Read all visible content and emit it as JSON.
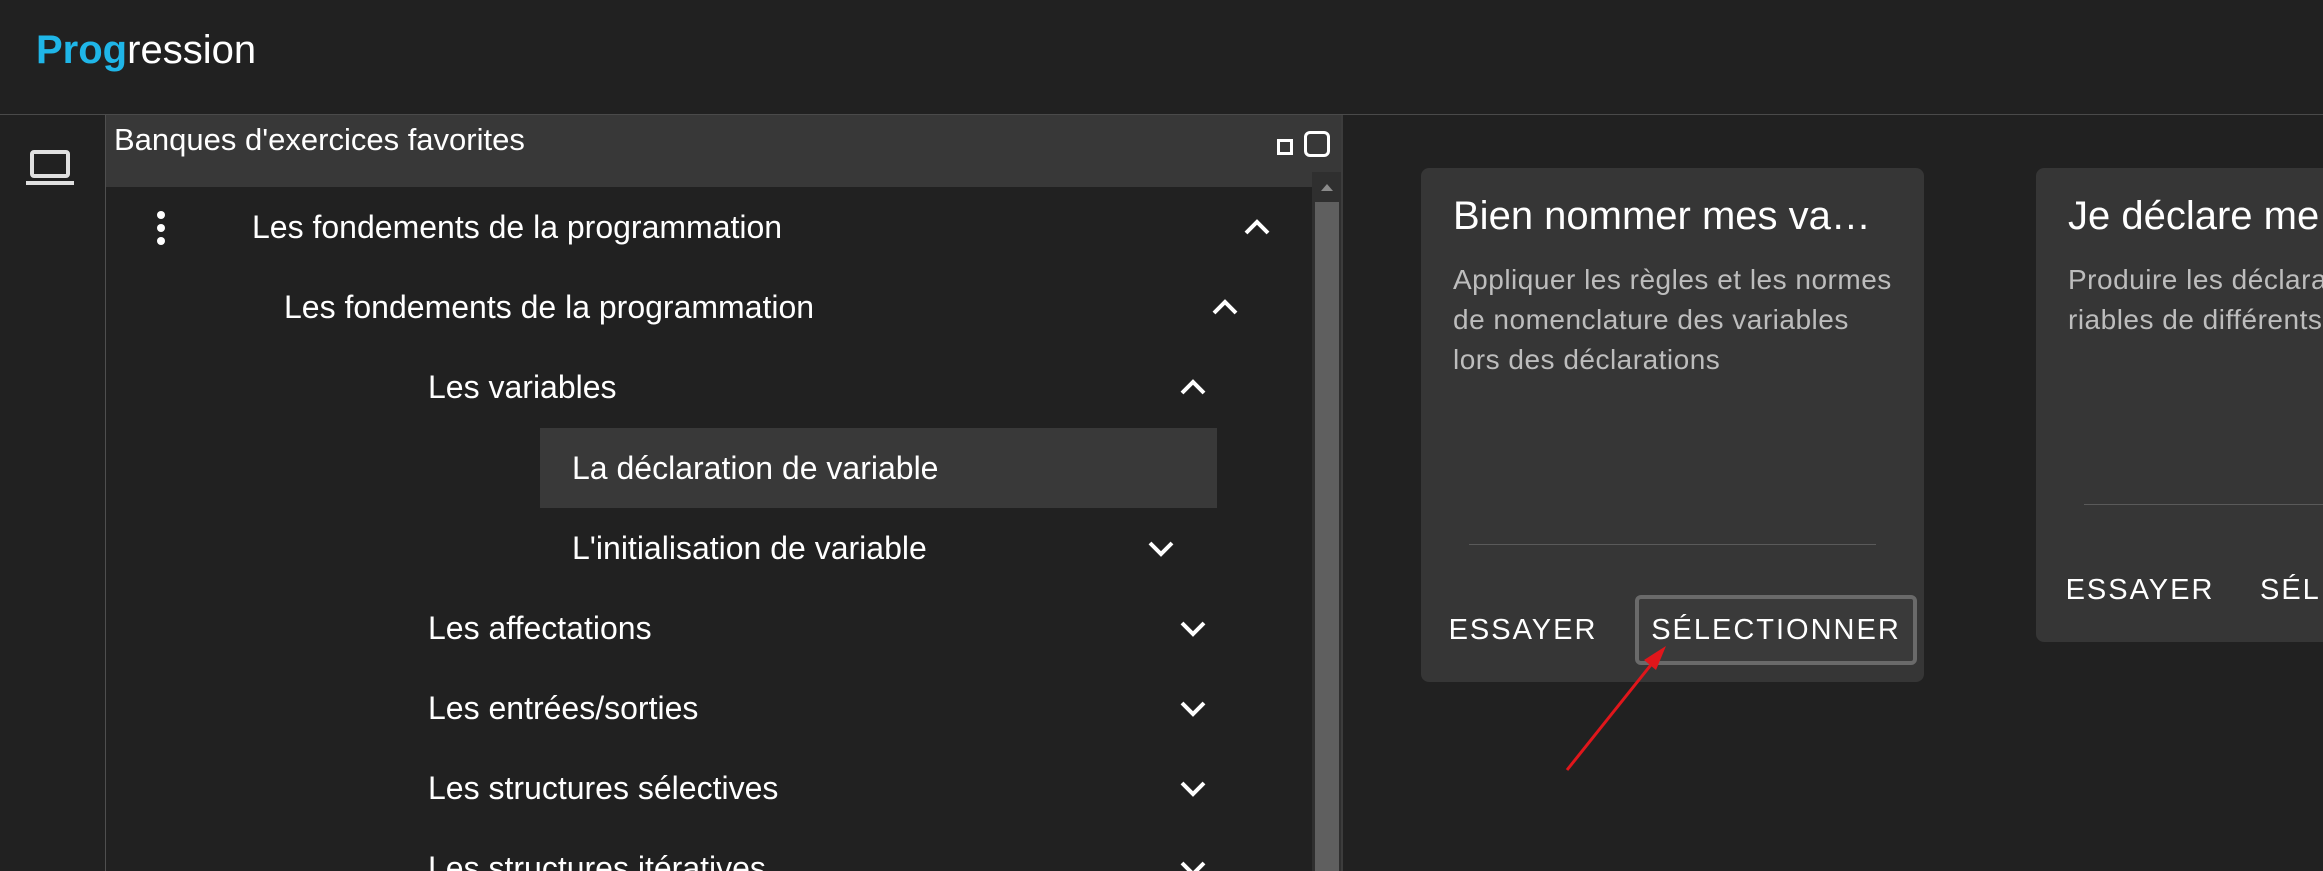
{
  "app": {
    "logo_accent": "Prog",
    "logo_rest": "ression",
    "accent_color": "#1fb6e8"
  },
  "rail": {
    "icon": "laptop-icon"
  },
  "panel": {
    "title": "Banques d'exercices favorites",
    "minimize_icon": "small-square-icon",
    "maximize_icon": "square-icon",
    "tree": [
      {
        "label": "Les fondements de la programmation",
        "level": 0,
        "expanded": true,
        "has_menu": true
      },
      {
        "label": "Les fondements de la programmation",
        "level": 1,
        "expanded": true
      },
      {
        "label": "Les variables",
        "level": 2,
        "expanded": true
      },
      {
        "label": "La déclaration de variable",
        "level": 3,
        "selected": true
      },
      {
        "label": "L'initialisation de variable",
        "level": 3,
        "expanded": false
      },
      {
        "label": "Les affectations",
        "level": 2,
        "expanded": false
      },
      {
        "label": "Les entrées/sorties",
        "level": 2,
        "expanded": false
      },
      {
        "label": "Les structures sélectives",
        "level": 2,
        "expanded": false
      },
      {
        "label": "Les structures itératives",
        "level": 2,
        "expanded": false
      }
    ]
  },
  "cards": [
    {
      "title": "Bien nommer mes va…",
      "description": "Appliquer les règles et les normes de nomenclature des variables lors des déclarations",
      "try_label": "ESSAYER",
      "select_label": "SÉLECTIONNER"
    },
    {
      "title": "Je déclare me",
      "description": "Produire les déclara riables de différents",
      "try_label": "ESSAYER",
      "select_label": "SÉL"
    }
  ],
  "annotation": {
    "color": "#e0161b",
    "icon": "red-arrow-icon"
  }
}
